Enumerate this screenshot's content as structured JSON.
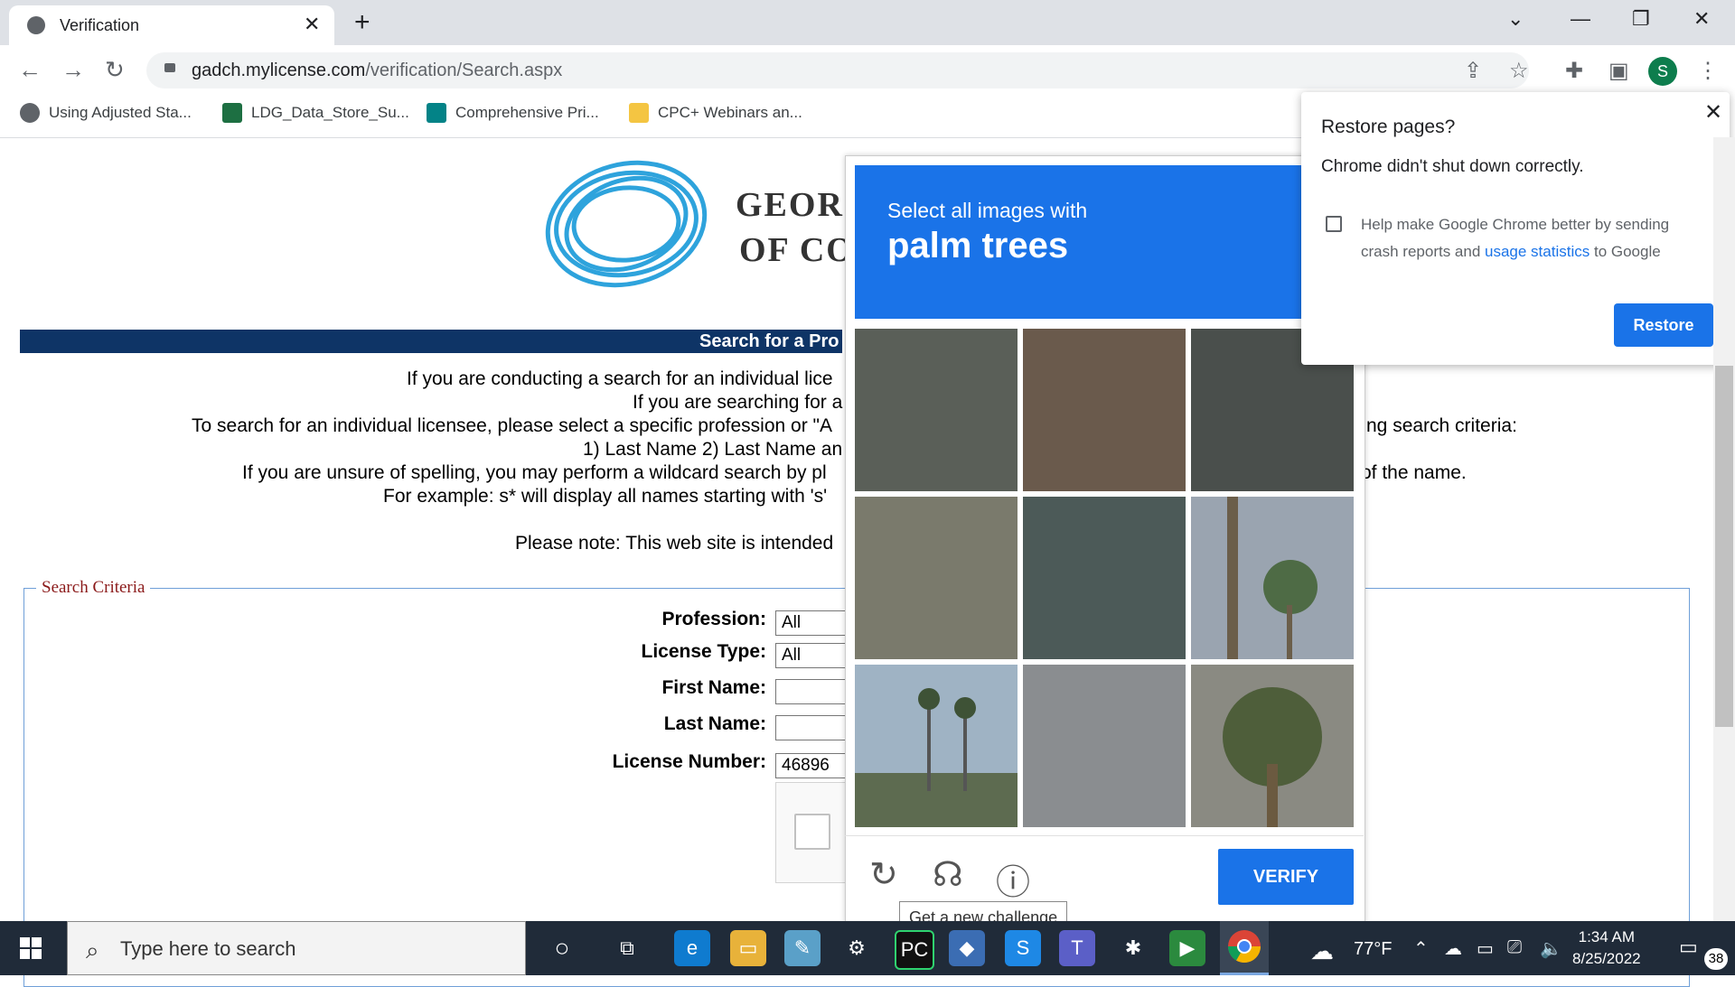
{
  "browser": {
    "tab_title": "Verification",
    "new_tab": "+",
    "tab_close": "✕",
    "window_controls": [
      "⌄",
      "—",
      "❐",
      "✕"
    ],
    "url_domain": "gadch.mylicense.com",
    "url_path": "/verification/Search.aspx",
    "avatar_letter": "S",
    "bookmarks": [
      {
        "label": "Using Adjusted Sta...",
        "icon": "globe-icon",
        "color": "#5f6368"
      },
      {
        "label": "LDG_Data_Store_Su...",
        "icon": "excel-icon",
        "color": "#1d6f42"
      },
      {
        "label": "Comprehensive Pri...",
        "icon": "sharepoint-icon",
        "color": "#038387"
      },
      {
        "label": "CPC+ Webinars an...",
        "icon": "folder-icon",
        "color": "#f4c542"
      }
    ]
  },
  "page": {
    "logo_line1": "GEOR",
    "logo_line2": "OF CO",
    "bar_title": "Search for a Pro",
    "paragraph_lines": [
      "If you are conducting a search for an individual lice",
      "If you are searching for a",
      "To search for an individual licensee, please select a specific profession or \"A",
      "1) Last Name 2) Last Name an",
      "If you are unsure of spelling, you may perform a wildcard search by pl",
      "For example: s* will display all names starting with 's'",
      "Please note: This web site is intended"
    ],
    "right_fragments": [
      "ng search criteria:",
      "of the name."
    ],
    "legend": "Search Criteria",
    "fields": [
      {
        "label": "Profession:",
        "value": "All"
      },
      {
        "label": "License Type:",
        "value": "All"
      },
      {
        "label": "First Name:",
        "value": ""
      },
      {
        "label": "Last Name:",
        "value": ""
      },
      {
        "label": "License Number:",
        "value": "46896"
      }
    ]
  },
  "captcha": {
    "instruction": "Select all images with",
    "target": "palm trees",
    "verify_label": "VERIFY",
    "tooltip": "Get a new challenge",
    "tiles": [
      {
        "desc": "overpass",
        "color": "#5a5f58"
      },
      {
        "desc": "road",
        "color": "#6a5a4c"
      },
      {
        "desc": "street-overpass",
        "color": "#4a4f4c"
      },
      {
        "desc": "house",
        "color": "#7a7a6c"
      },
      {
        "desc": "building",
        "color": "#4c5a58"
      },
      {
        "desc": "palm-trees",
        "color": "#9aa4b0"
      },
      {
        "desc": "palm-trees",
        "color": "#9fb3c4"
      },
      {
        "desc": "intersection",
        "color": "#8a8d90"
      },
      {
        "desc": "palm-tree",
        "color": "#8a8a82"
      }
    ]
  },
  "restore_popup": {
    "title": "Restore pages?",
    "subtitle": "Chrome didn't shut down correctly.",
    "help_text_before": "Help make Google Chrome better by sending crash reports and ",
    "help_link": "usage statistics",
    "help_text_after": " to Google",
    "restore_label": "Restore",
    "close": "✕"
  },
  "taskbar": {
    "search_placeholder": "Type here to search",
    "weather": "77°F",
    "time": "1:34 AM",
    "date": "8/25/2022",
    "notifications": "38"
  }
}
